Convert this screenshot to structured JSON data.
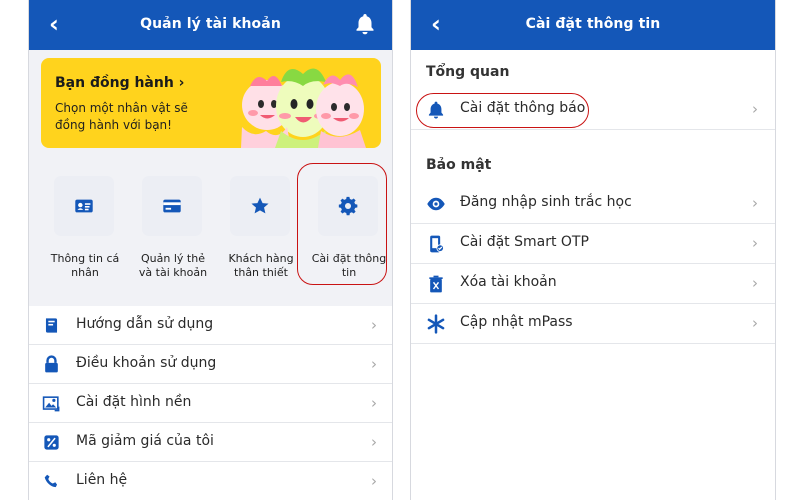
{
  "left": {
    "header": {
      "title": "Quản lý tài khoản"
    },
    "banner": {
      "title": "Bạn đồng hành ›",
      "text": "Chọn một nhân vật sẽ đồng hành với bạn!"
    },
    "shortcuts": [
      {
        "label": "Thông tin cá nhân",
        "icon": "id-card-icon"
      },
      {
        "label": "Quản lý thẻ và tài khoản",
        "icon": "credit-card-icon"
      },
      {
        "label": "Khách hàng thân thiết",
        "icon": "star-icon"
      },
      {
        "label": "Cài đặt thông tin",
        "icon": "gear-icon"
      }
    ],
    "menu": [
      {
        "label": "Hướng dẫn sử dụng",
        "icon": "book-icon"
      },
      {
        "label": "Điều khoản sử dụng",
        "icon": "lock-icon"
      },
      {
        "label": "Cài đặt hình nền",
        "icon": "image-icon"
      },
      {
        "label": "Mã giảm giá của tôi",
        "icon": "percent-icon"
      },
      {
        "label": "Liên hệ",
        "icon": "phone-icon"
      }
    ]
  },
  "right": {
    "header": {
      "title": "Cài đặt thông tin"
    },
    "sections": [
      {
        "title": "Tổng quan",
        "items": [
          {
            "label": "Cài đặt thông báo",
            "icon": "bell-icon"
          }
        ]
      },
      {
        "title": "Bảo mật",
        "items": [
          {
            "label": "Đăng nhập sinh trắc học",
            "icon": "eye-icon"
          },
          {
            "label": "Cài đặt Smart OTP",
            "icon": "smart-otp-icon"
          },
          {
            "label": "Xóa tài khoản",
            "icon": "trash-icon"
          },
          {
            "label": "Cập nhật mPass",
            "icon": "asterisk-icon"
          }
        ]
      }
    ]
  },
  "colors": {
    "primary": "#1457b8",
    "banner": "#ffd31d",
    "highlight": "#c91313",
    "background": "#f1f2f6"
  }
}
